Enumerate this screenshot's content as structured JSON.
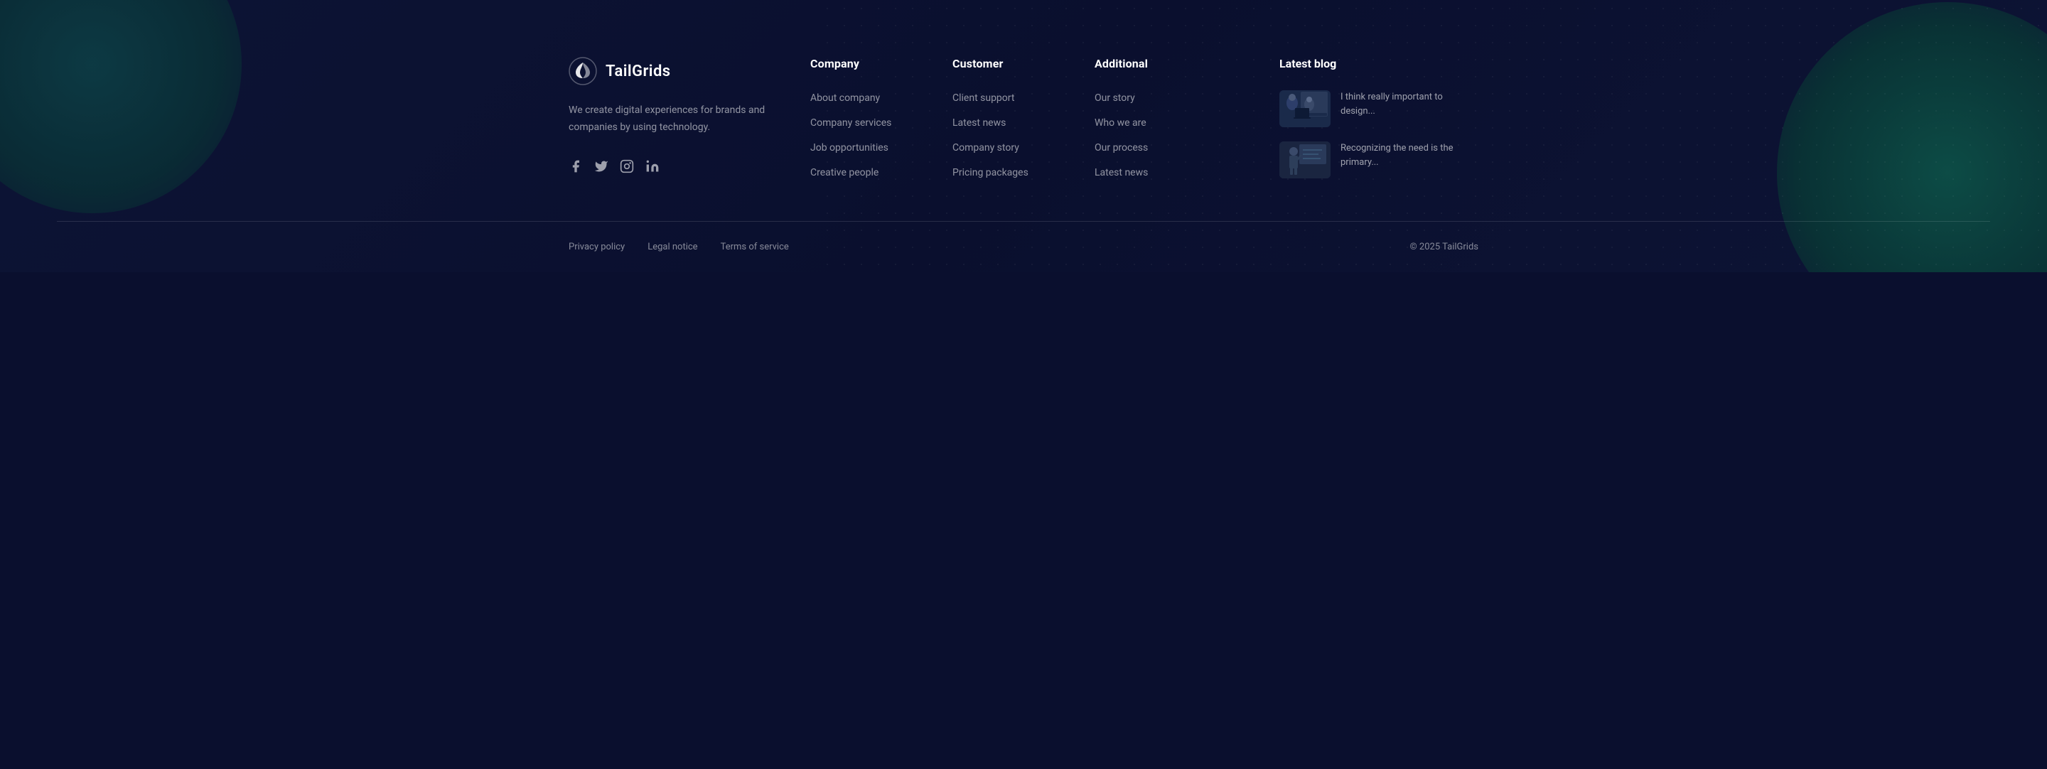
{
  "brand": {
    "logo_text": "TailGrids",
    "description": "We create digital experiences for brands and companies by using technology.",
    "social": [
      {
        "name": "facebook",
        "label": "Facebook"
      },
      {
        "name": "twitter",
        "label": "Twitter"
      },
      {
        "name": "instagram",
        "label": "Instagram"
      },
      {
        "name": "linkedin",
        "label": "LinkedIn"
      }
    ]
  },
  "columns": [
    {
      "id": "company",
      "title": "Company",
      "links": [
        {
          "label": "About company",
          "href": "#"
        },
        {
          "label": "Company services",
          "href": "#"
        },
        {
          "label": "Job opportunities",
          "href": "#"
        },
        {
          "label": "Creative people",
          "href": "#"
        }
      ]
    },
    {
      "id": "customer",
      "title": "Customer",
      "links": [
        {
          "label": "Client support",
          "href": "#"
        },
        {
          "label": "Latest news",
          "href": "#"
        },
        {
          "label": "Company story",
          "href": "#"
        },
        {
          "label": "Pricing packages",
          "href": "#"
        }
      ]
    },
    {
      "id": "additional",
      "title": "Additional",
      "links": [
        {
          "label": "Our story",
          "href": "#"
        },
        {
          "label": "Who we are",
          "href": "#"
        },
        {
          "label": "Our process",
          "href": "#"
        },
        {
          "label": "Latest news",
          "href": "#"
        }
      ]
    }
  ],
  "blog": {
    "title": "Latest blog",
    "items": [
      {
        "id": "blog-1",
        "text": "I think really important to design..."
      },
      {
        "id": "blog-2",
        "text": "Recognizing the need is the primary..."
      }
    ]
  },
  "footer": {
    "legal_links": [
      {
        "label": "Privacy policy",
        "href": "#"
      },
      {
        "label": "Legal notice",
        "href": "#"
      },
      {
        "label": "Terms of service",
        "href": "#"
      }
    ],
    "copyright": "© 2025 TailGrids"
  }
}
